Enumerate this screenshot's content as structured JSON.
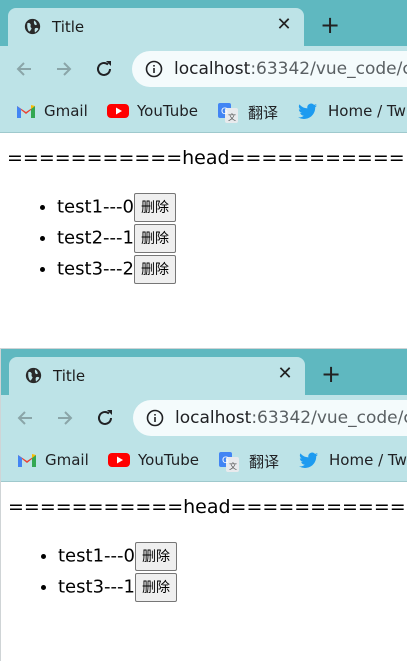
{
  "windows": [
    {
      "tab_title": "Title",
      "url_host": "localhost",
      "url_rest": ":63342/vue_code/c",
      "bookmarks": [
        {
          "label": "Gmail",
          "icon": "gmail-icon"
        },
        {
          "label": "YouTube",
          "icon": "youtube-icon"
        },
        {
          "label": "翻译",
          "icon": "translate-icon"
        },
        {
          "label": "Home / Tw",
          "icon": "twitter-icon"
        }
      ],
      "head_text": "===========head===========",
      "items": [
        {
          "text": "test1---0",
          "button": "删除"
        },
        {
          "text": "test2---1",
          "button": "删除"
        },
        {
          "text": "test3---2",
          "button": "删除"
        }
      ]
    },
    {
      "tab_title": "Title",
      "url_host": "localhost",
      "url_rest": ":63342/vue_code/c",
      "bookmarks": [
        {
          "label": "Gmail",
          "icon": "gmail-icon"
        },
        {
          "label": "YouTube",
          "icon": "youtube-icon"
        },
        {
          "label": "翻译",
          "icon": "translate-icon"
        },
        {
          "label": "Home / Tw",
          "icon": "twitter-icon"
        }
      ],
      "head_text": "===========head===========",
      "items": [
        {
          "text": "test1---0",
          "button": "删除"
        },
        {
          "text": "test3---1",
          "button": "删除"
        }
      ]
    }
  ],
  "colors": {
    "tab_strip": "#5fb8c0",
    "toolbar": "#bde3e7",
    "twitter": "#1d9bf0",
    "youtube": "#ff0000"
  }
}
